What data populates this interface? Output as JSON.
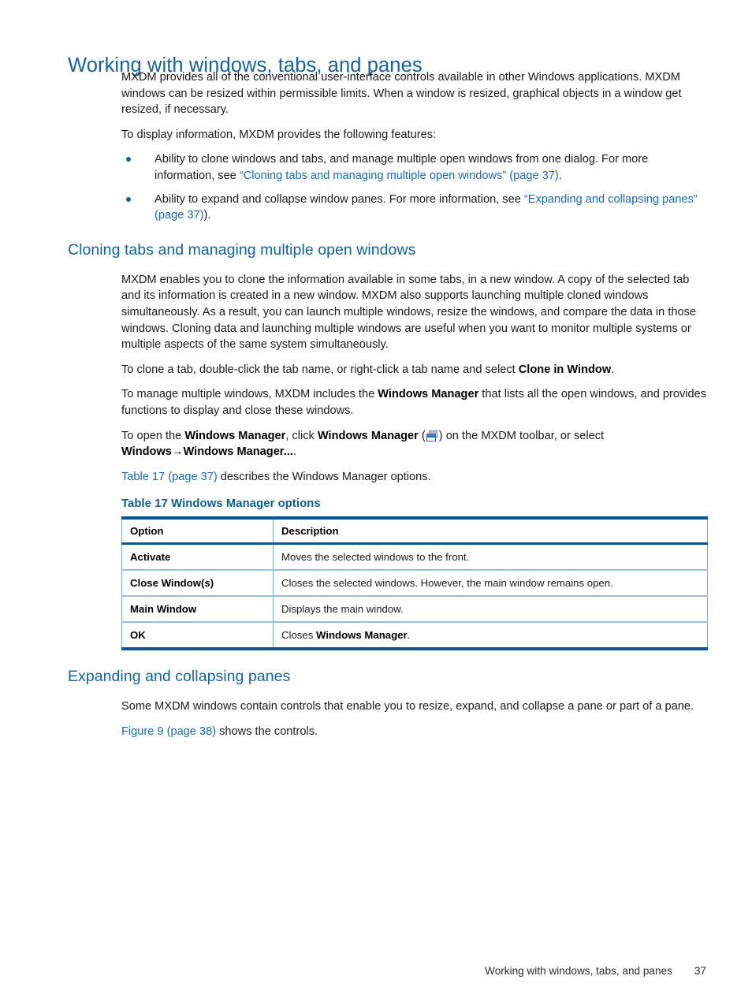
{
  "document": {
    "title": "Working with windows, tabs, and panes"
  },
  "intro": {
    "paragraph1": "MXDM provides all of the conventional user-interface controls available in other Windows applications. MXDM windows can be resized within permissible limits. When a window is resized, graphical objects in a window get resized, if necessary.",
    "paragraph2": "To display information, MXDM provides the following features:"
  },
  "features": {
    "bullet1": {
      "lead": "Ability to clone windows and tabs, and manage multiple open windows from one dialog. For more information, see ",
      "link": "“Cloning tabs and managing multiple open windows” (page 37)",
      "tail": "."
    },
    "bullet2": {
      "lead": "Ability to expand and collapse window panes. For more information, see ",
      "link": "“Expanding and collapsing panes” (page 37)",
      "tail": ")."
    }
  },
  "cloning_section": {
    "heading": "Cloning tabs and managing multiple open windows",
    "paragraph1": "MXDM enables you to clone the information available in some tabs, in a new window. A copy of the selected tab and its information is created in a new window. MXDM also supports launching multiple cloned windows simultaneously. As a result, you can launch multiple windows, resize the windows, and compare the data in those windows. Cloning data and launching multiple windows are useful when you want to monitor multiple systems or multiple aspects of the same system simultaneously.",
    "paragraph2": {
      "lead": "To clone a tab, double-click the tab name, or right-click a tab name and select ",
      "bold": "Clone in Window",
      "tail": "."
    },
    "paragraph3": {
      "lead": "To manage multiple windows, MXDM includes the ",
      "bold": "Windows Manager",
      "tail": " that lists all the open windows, and provides functions to display and close these windows."
    },
    "paragraph4": {
      "part1": "To open the ",
      "bold1": "Windows Manager",
      "part2": ", click ",
      "bold2": "Windows Manager",
      "part3": " (",
      "icon": "windows-manager-toolbar-icon",
      "part4": ") on the MXDM toolbar, or select ",
      "bold3": "Windows→Windows Manager...",
      "part5": "."
    },
    "paragraph5": {
      "link": "Table 17 (page 37)",
      "tail": " describes the Windows Manager options."
    }
  },
  "table17": {
    "caption": "Table 17 Windows Manager options",
    "columns": [
      "Option",
      "Description"
    ],
    "rows": [
      {
        "option": "Activate",
        "description": "Moves the selected windows to the front.",
        "description_bold": "",
        "description_tail": ""
      },
      {
        "option": "Close Window(s)",
        "description": "Closes the selected windows. However, the main window remains open.",
        "description_bold": "",
        "description_tail": ""
      },
      {
        "option": "Main Window",
        "description": "Displays the main window.",
        "description_bold": "",
        "description_tail": ""
      },
      {
        "option": "OK",
        "description": "Closes ",
        "description_bold": "Windows Manager",
        "description_tail": "."
      }
    ]
  },
  "panes_section": {
    "heading": "Expanding and collapsing panes",
    "paragraph1": "Some MXDM windows contain controls that enable you to resize, expand, and collapse a pane or part of a pane.",
    "paragraph2": {
      "link": "Figure 9 (page 38)",
      "tail": " shows the controls."
    }
  },
  "footer": {
    "chapter": "Working with windows, tabs, and panes",
    "page_number": "37"
  },
  "colors": {
    "heading_blue": "#15629c",
    "link_blue": "#1a6aad",
    "caption_blue": "#0d5a96",
    "table_rule_dark": "#0b5394",
    "table_rule_light": "#9dbcd8"
  }
}
